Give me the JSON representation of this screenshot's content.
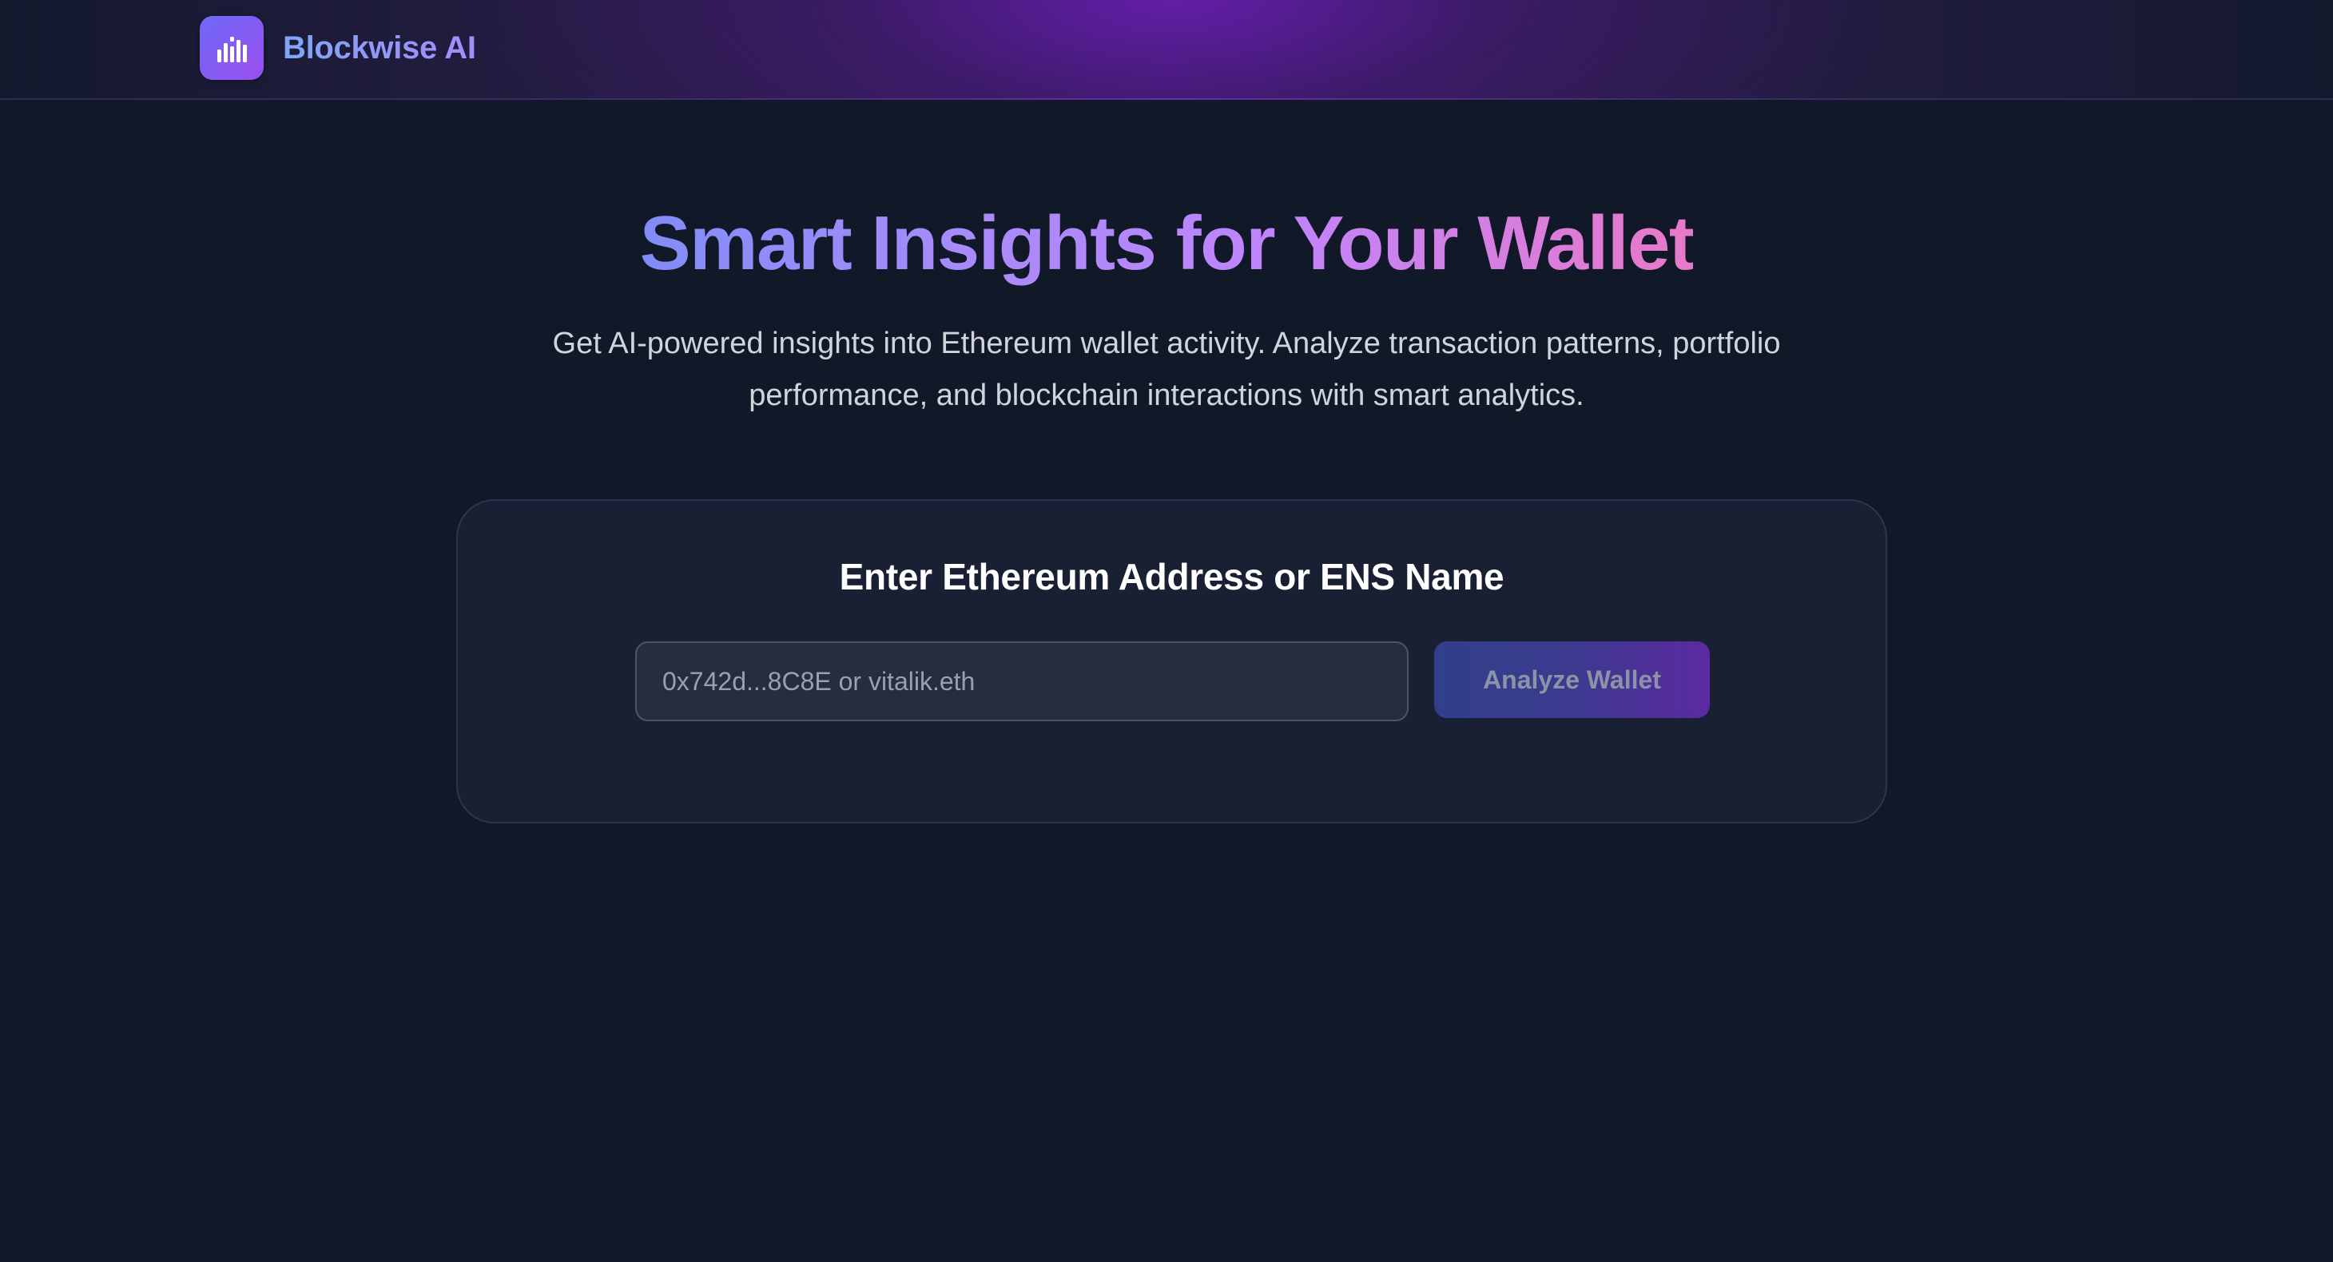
{
  "header": {
    "brand_name": "Blockwise AI",
    "logo_icon": "bar-chart-icon"
  },
  "hero": {
    "title": "Smart Insights for Your Wallet",
    "subtitle": "Get AI-powered insights into Ethereum wallet activity. Analyze transaction patterns, portfolio performance, and blockchain interactions with smart analytics."
  },
  "search_card": {
    "title": "Enter Ethereum Address or ENS Name",
    "input_placeholder": "0x742d...8C8E or vitalik.eth",
    "input_value": "",
    "button_label": "Analyze Wallet"
  },
  "colors": {
    "background": "#111827",
    "card_background": "#1a2033",
    "accent_start": "#818cf8",
    "accent_end": "#e879c9"
  }
}
